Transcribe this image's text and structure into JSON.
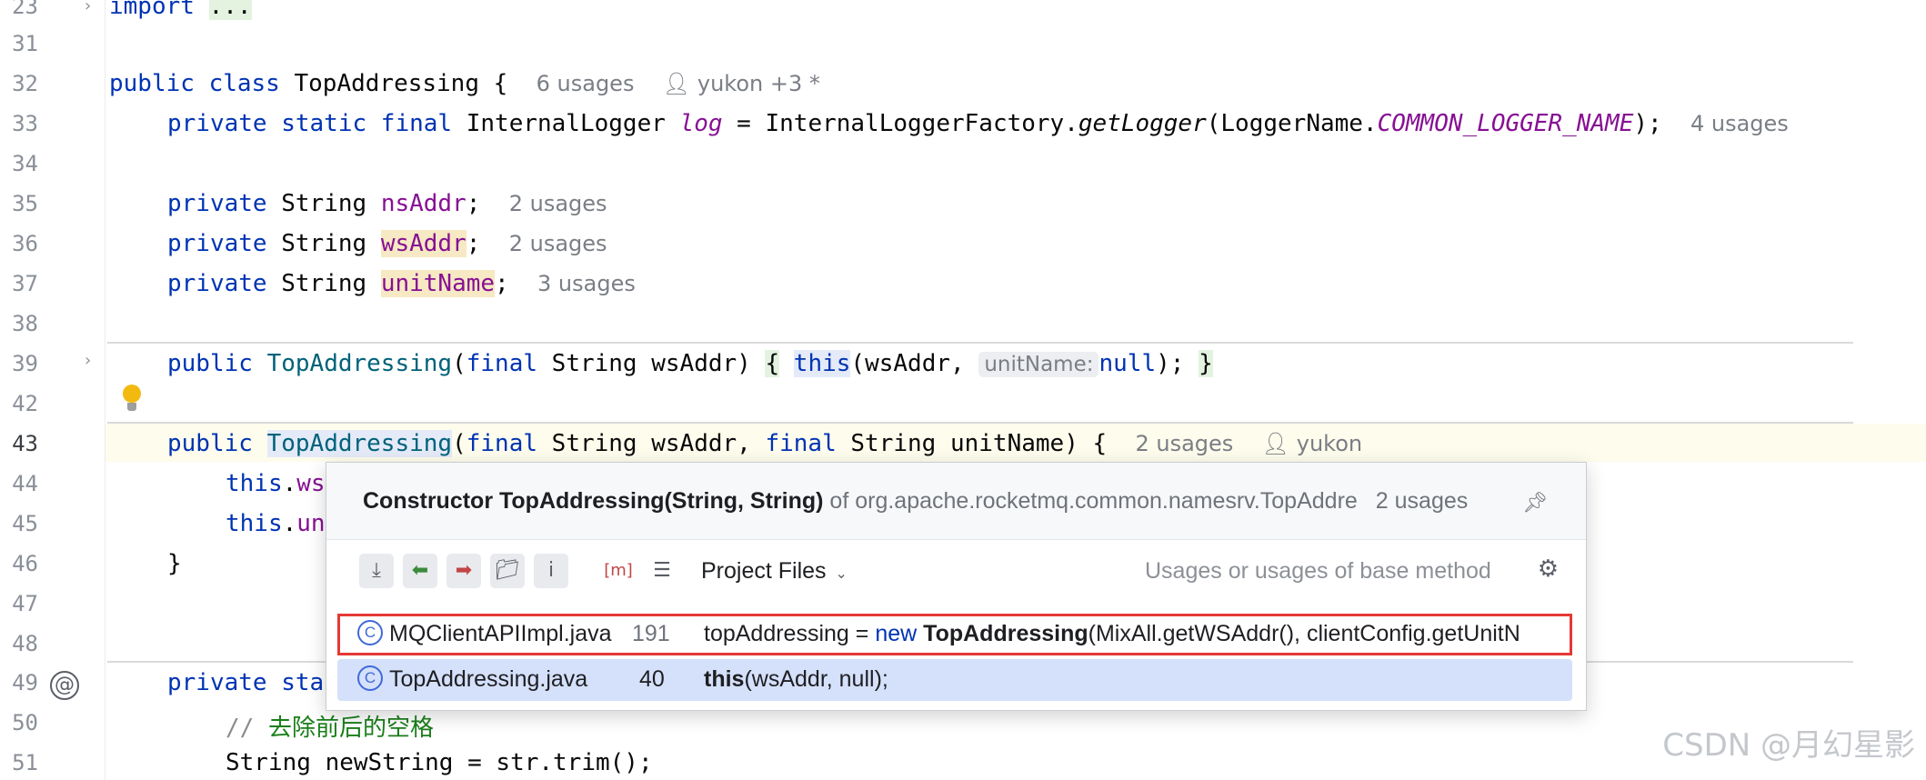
{
  "editor": {
    "line_numbers": [
      "23",
      "31",
      "32",
      "33",
      "34",
      "35",
      "36",
      "37",
      "38",
      "39",
      "42",
      "43",
      "44",
      "45",
      "46",
      "47",
      "48",
      "49",
      "50",
      "51"
    ],
    "lines": {
      "l23": {
        "kw": "import",
        "folded": "..."
      },
      "l32": {
        "kw": "public class",
        "name": "TopAddressing",
        "brace": "{",
        "usages": "6 usages",
        "author": "yukon +3 *"
      },
      "l33": {
        "mods": "private static final",
        "type": "InternalLogger",
        "var": "log",
        "eq": "=",
        "cls": "InternalLoggerFactory.",
        "method": "getLogger",
        "arg_open": "(LoggerName.",
        "const": "COMMON_LOGGER_NAME",
        "arg_close": ");",
        "usages": "4 usages"
      },
      "l35": {
        "mods": "private",
        "type": "String",
        "field": "nsAddr",
        "semi": ";",
        "usages": "2 usages"
      },
      "l36": {
        "mods": "private",
        "type": "String",
        "field": "wsAddr",
        "semi": ";",
        "usages": "2 usages"
      },
      "l37": {
        "mods": "private",
        "type": "String",
        "field": "unitName",
        "semi": ";",
        "usages": "3 usages"
      },
      "l39": {
        "mods": "public",
        "name": "TopAddressing",
        "p1": "(",
        "p1kw": "final",
        "p1rest": " String wsAddr)",
        "brace": "{",
        "this": "this",
        "call": "(wsAddr,",
        "hint": "unitName:",
        "null": "null",
        "end": ");",
        "close": "}"
      },
      "l43": {
        "mods": "public",
        "name": "TopAddressing",
        "paren": "(",
        "kw1": "final",
        "mid1": " String wsAddr, ",
        "kw2": "final",
        "mid2": " String unitName) {",
        "usages": "2 usages",
        "author": "yukon"
      },
      "l44": {
        "this": "this",
        "dot": ".",
        "rest": "ws"
      },
      "l45": {
        "this": "this",
        "dot": ".",
        "rest": "un"
      },
      "l46": {
        "brace": "}"
      },
      "l49": {
        "mods": "private",
        "rest": "sta"
      },
      "l50": {
        "slashes": "//",
        "comment": "去除前后的空格"
      },
      "l51": {
        "text": "String newString = str.trim();"
      }
    }
  },
  "popup": {
    "title_bold": "Constructor TopAddressing(String, String)",
    "title_of": "of org.apache.rocketmq.common.namesrv.TopAddre",
    "usages": "2 usages",
    "scope": "Project Files",
    "filter_hint": "Usages or usages of base method",
    "toolbar_icons": [
      "merge-usages-icon",
      "read-access-icon",
      "write-access-icon",
      "directory-icon",
      "info-icon",
      "method-icon",
      "preview-icon"
    ],
    "results": [
      {
        "file": "MQClientAPIImpl.java",
        "line": "191",
        "pre": "topAddressing = ",
        "kw": "new",
        "bold": "TopAddressing",
        "post": "(MixAll.getWSAddr(), clientConfig.getUnitN"
      },
      {
        "file": "TopAddressing.java",
        "line": "40",
        "bold": "this",
        "post": "(wsAddr, null);"
      }
    ]
  },
  "watermark": "CSDN @月幻星影",
  "colors": {
    "keyword": "#0033b3",
    "field": "#871094",
    "method": "#00627a",
    "highlight_red": "#e53935",
    "selected_row": "#d5e0fb"
  }
}
